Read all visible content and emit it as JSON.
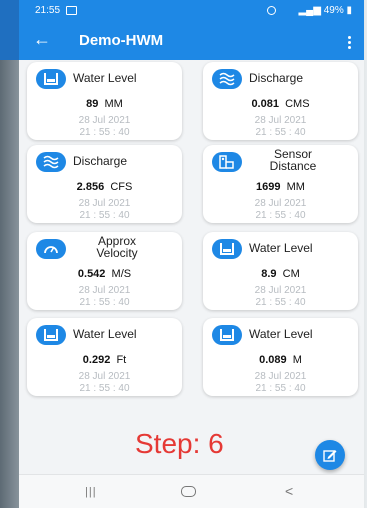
{
  "status": {
    "time": "21:55",
    "battery": "49%"
  },
  "appbar": {
    "title": "Demo-HWM"
  },
  "cards": [
    {
      "label": "Water Level",
      "icon": "water-level-icon",
      "value": "89",
      "unit": "MM",
      "date": "28 Jul 2021",
      "time": "21 : 55 : 40"
    },
    {
      "label": "Discharge",
      "icon": "discharge-icon",
      "value": "0.081",
      "unit": "CMS",
      "date": "28 Jul 2021",
      "time": "21 : 55 : 40"
    },
    {
      "label": "Discharge",
      "icon": "discharge-icon",
      "value": "2.856",
      "unit": "CFS",
      "date": "28 Jul 2021",
      "time": "21 : 55 : 40"
    },
    {
      "label_line1": "Sensor",
      "label_line2": "Distance",
      "icon": "sensor-distance-icon",
      "value": "1699",
      "unit": "MM",
      "date": "28 Jul 2021",
      "time": "21 : 55 : 40"
    },
    {
      "label_line1": "Approx",
      "label_line2": "Velocity",
      "icon": "speedometer-icon",
      "value": "0.542",
      "unit": "M/S",
      "date": "28 Jul 2021",
      "time": "21 : 55 : 40"
    },
    {
      "label": "Water Level",
      "icon": "water-level-icon",
      "value": "8.9",
      "unit": "CM",
      "date": "28 Jul 2021",
      "time": "21 : 55 : 40"
    },
    {
      "label": "Water Level",
      "icon": "water-level-icon",
      "value": "0.292",
      "unit": "Ft",
      "date": "28 Jul 2021",
      "time": "21 : 55 : 40"
    },
    {
      "label": "Water Level",
      "icon": "water-level-icon",
      "value": "0.089",
      "unit": "M",
      "date": "28 Jul 2021",
      "time": "21 : 55 : 40"
    }
  ],
  "overlay": {
    "step_text": "Step: 6"
  },
  "colors": {
    "primary": "#1e88e5",
    "step_red": "#e53935"
  }
}
